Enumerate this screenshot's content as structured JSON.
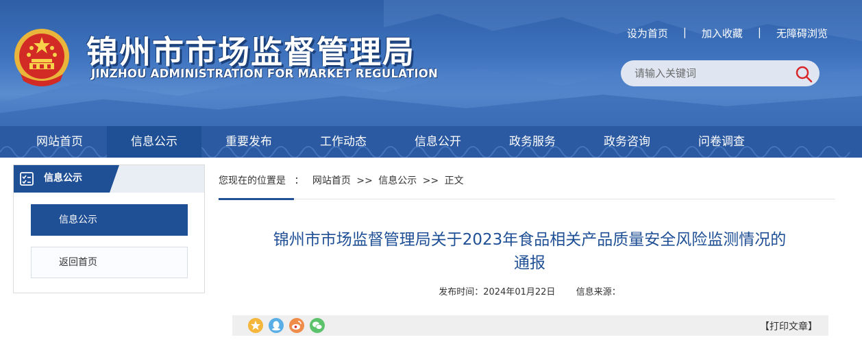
{
  "header": {
    "site_title": "锦州市市场监督管理局",
    "site_subtitle": "JINZHOU ADMINISTRATION FOR MARKET REGULATION",
    "top_links": [
      "设为首页",
      "加入收藏",
      "无障碍浏览"
    ],
    "separator": "|",
    "search_placeholder": "请输入关键词"
  },
  "nav": {
    "items": [
      "网站首页",
      "信息公示",
      "重要发布",
      "工作动态",
      "信息公开",
      "政务服务",
      "政务咨询",
      "问卷调查"
    ],
    "active_index": 1
  },
  "sidebar": {
    "title": "信息公示",
    "items": [
      "信息公示",
      "返回首页"
    ]
  },
  "breadcrumb": {
    "prefix": "您现在的位置是",
    "colon": "：",
    "items": [
      "网站首页",
      "信息公示",
      "正文"
    ],
    "separator": ">>"
  },
  "article": {
    "title_line1": "锦州市市场监督管理局关于2023年食品相关产品质量安全风险监测情况的",
    "title_line2": "通报",
    "publish_label": "发布时间：",
    "publish_date": "2024年01月22日",
    "source_label": "信息来源："
  },
  "share": {
    "icons": [
      "favorite-icon",
      "qq-icon",
      "weibo-icon",
      "wechat-icon"
    ],
    "print_label": "【打印文章】"
  },
  "colors": {
    "primary": "#1f4f95",
    "banner": "#3e73bf",
    "title": "#1f4f95"
  }
}
